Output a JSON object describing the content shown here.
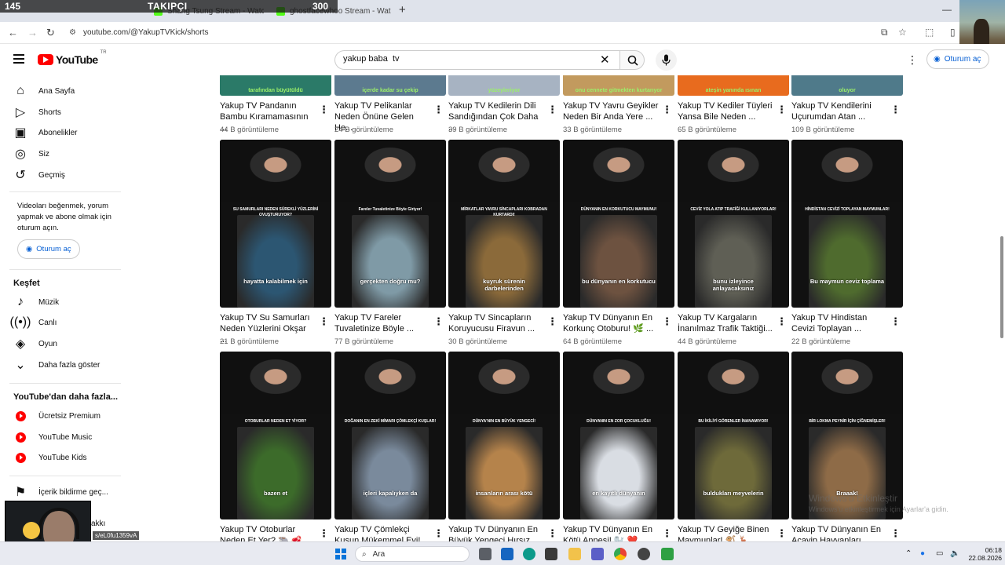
{
  "stream_overlay": {
    "left": "145",
    "mid": "TAKIPÇI",
    "right": "300"
  },
  "browser": {
    "tabs": [
      {
        "title": "Shang Tsung Stream - Watc"
      },
      {
        "title": "ghostfacewhoo Stream - Watc"
      }
    ],
    "url": "youtube.com/@YakupTVKick/shorts"
  },
  "header": {
    "logo_text": "YouTube",
    "logo_sup": "TR",
    "search_value": "yakup baba  tv",
    "signin_label": "Oturum aç"
  },
  "sidebar": {
    "main_items": [
      {
        "label": "Ana Sayfa",
        "icon": "home-icon"
      },
      {
        "label": "Shorts",
        "icon": "shorts-icon"
      },
      {
        "label": "Abonelikler",
        "icon": "subscriptions-icon"
      },
      {
        "label": "Siz",
        "icon": "you-icon"
      },
      {
        "label": "Geçmiş",
        "icon": "history-icon"
      }
    ],
    "note": "Videoları beğenmek, yorum yapmak ve abone olmak için oturum açın.",
    "signin_label": "Oturum aç",
    "explore_heading": "Keşfet",
    "explore_items": [
      {
        "label": "Müzik",
        "icon": "music-icon"
      },
      {
        "label": "Canlı",
        "icon": "live-icon"
      },
      {
        "label": "Oyun",
        "icon": "gaming-icon"
      },
      {
        "label": "Daha fazla göster",
        "icon": "chevron-down-icon"
      }
    ],
    "more_heading": "YouTube'dan daha fazla...",
    "more_items": [
      {
        "label": "Ücretsiz Premium"
      },
      {
        "label": "YouTube Music"
      },
      {
        "label": "YouTube Kids"
      }
    ],
    "report_label": "İçerik bildirme geç...",
    "bottom_text": "akkı"
  },
  "link_tooltip": "s/eL0fu1359vA",
  "videos_row1": [
    {
      "title": "Yakup TV Pandanın Bambu Kıramamasının ...",
      "views": "44 B görüntüleme",
      "thumb_text": "tarafından büyütüldü"
    },
    {
      "title": "Yakup TV Pelikanlar Neden Önüne Gelen He...",
      "views": "24 B görüntüleme",
      "thumb_text": "içerde kadar su çekip"
    },
    {
      "title": "Yakup TV Kedilerin Dili Sandığından Çok Daha ...",
      "views": "39 B görüntüleme",
      "thumb_text": "yüzeyleriyor"
    },
    {
      "title": "Yakup TV Yavru Geyikler Neden Bir Anda Yere ...",
      "views": "33 B görüntüleme",
      "thumb_text": "onu cennete gitmekten kurtarıyor"
    },
    {
      "title": "Yakup TV Kediler Tüyleri Yansa Bile Neden ...",
      "views": "65 B görüntüleme",
      "thumb_text": "ateşin yanında ısınan"
    },
    {
      "title": "Yakup TV Kendilerini Uçurumdan Atan ...",
      "views": "109 B görüntüleme",
      "thumb_text": "oluyor"
    }
  ],
  "videos_row2": [
    {
      "title": "Yakup TV Su Samurları Neden Yüzlerini Okşar ...",
      "views": "21 B görüntüleme",
      "caption": "SU SAMURLARI NEDEN SÜREKLİ YÜZLERİNİ OVUŞTURUYOR?",
      "sub": "hayatta kalabilmek için",
      "color": "#2c5672"
    },
    {
      "title": "Yakup TV Fareler Tuvaletinize Böyle ...",
      "views": "77 B görüntüleme",
      "caption": "Fareler Tuvaletinize Böyle Giriyor!",
      "sub": "gerçekten doğru mu?",
      "color": "#7f9aa6"
    },
    {
      "title": "Yakup TV Sincapların Koruyucusu Firavun ...",
      "views": "30 B görüntüleme",
      "caption": "MİRKATLAR YAVRU SİNCAPLARI KOBRADAN KURTARDI!",
      "sub": "kuyruk sürenin darbelerinden",
      "color": "#8b6a3a"
    },
    {
      "title": "Yakup TV Dünyanın En Korkunç Otoburu! 🌿 ...",
      "views": "64 B görüntüleme",
      "caption": "DÜNYANIN EN KORKUTUCU MAYMUNU!",
      "sub": "bu dünyanın en korkutucu",
      "color": "#6d5240"
    },
    {
      "title": "Yakup TV Kargaların İnanılmaz Trafik Taktiği...",
      "views": "44 B görüntüleme",
      "caption": "CEVİZ YOLA ATIP TRAFİĞİ KULLANIYORLAR!",
      "sub": "bunu izleyince anlayacaksınız",
      "color": "#5f5f55"
    },
    {
      "title": "Yakup TV Hindistan Cevizi Toplayan ...",
      "views": "22 B görüntüleme",
      "caption": "HİNDİSTAN CEVİZİ TOPLAYAN MAYMUNLAR!",
      "sub": "Bu maymun ceviz toplama",
      "color": "#4f6b2e"
    }
  ],
  "videos_row3": [
    {
      "title": "Yakup TV Otoburlar Neden Et Yer? 🐃 🥩",
      "caption": "OTOBURLAR NEDEN ET YİYOR?",
      "sub": "bazen et",
      "color": "#3c6b2a"
    },
    {
      "title": "Yakup TV Çömlekçi Kuşun Mükemmel Evi!",
      "caption": "DOĞANIN EN ZEKİ MİMARI ÇÖMLEKÇİ KUŞLAR!",
      "sub": "içleri kapalıyken da",
      "color": "#7a8a9c"
    },
    {
      "title": "Yakup TV Dünyanın En Büyük Yengeci Hırsız",
      "caption": "DÜNYA'NIN EN BÜYÜK YENGECİ!",
      "sub": "insanların arası kötü",
      "color": "#b5834b"
    },
    {
      "title": "Yakup TV Dünyanın En Kötü Annesi! 🦭 ❤️",
      "caption": "DÜNYANIN EN ZOR ÇOCUKLUĞU!",
      "sub": "en kayıtlı dünyanın",
      "color": "#d9dde3"
    },
    {
      "title": "Yakup TV Geyiğe Binen Maymunlar! 🐒 🦌",
      "caption": "BU İKİLİYİ GÖRENLER İNANAMIYOR!",
      "sub": "buldukları meyvelerin",
      "color": "#6e6a3a"
    },
    {
      "title": "Yakup TV Dünyanın En Acayip Hayvanları",
      "caption": "BİR LOKMA PEYNİR İÇİN ÇİĞNEMİŞLER!",
      "sub": "Braaak!",
      "color": "#8e6b47"
    }
  ],
  "watermark": {
    "line1": "Windows'u Etkinleştir",
    "line2": "Windows'u etkinleştirmek için Ayarlar'a gidin."
  },
  "taskbar": {
    "search_placeholder": "Ara",
    "time": "06:18",
    "date": "22.08.2026"
  }
}
